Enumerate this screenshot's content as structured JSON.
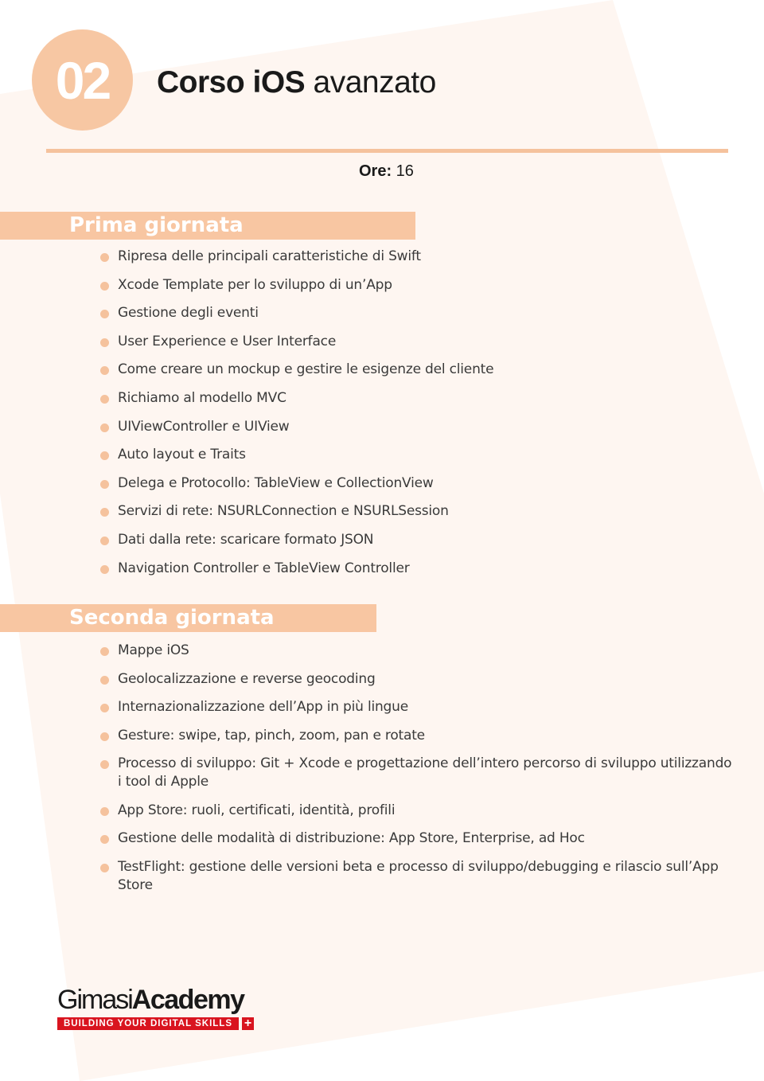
{
  "colors": {
    "accent": "#f8c6a2",
    "background_shape": "#fef6f1",
    "text": "#3a3a3a",
    "logo_red": "#d9141f"
  },
  "header": {
    "number": "02",
    "title_bold": "Corso iOS",
    "title_light": " avanzato",
    "hours_label": "Ore:",
    "hours_value": " 16"
  },
  "sections": [
    {
      "title": "Prima giornata",
      "items": [
        "Ripresa delle principali caratteristiche di Swift",
        "Xcode Template per lo sviluppo di un’App",
        "Gestione degli eventi",
        "User Experience e User Interface",
        "Come creare un mockup e gestire le esigenze del cliente",
        "Richiamo al modello MVC",
        "UIViewController e UIView",
        "Auto layout e Traits",
        "Delega e Protocollo: TableView e CollectionView",
        "Servizi di rete: NSURLConnection e NSURLSession",
        "Dati dalla rete: scaricare formato JSON",
        "Navigation Controller e TableView Controller"
      ]
    },
    {
      "title": "Seconda giornata",
      "items": [
        "Mappe iOS",
        "Geolocalizzazione  e reverse geocoding",
        "Internazionalizzazione dell’App in più lingue",
        "Gesture: swipe, tap, pinch, zoom, pan e rotate",
        "Processo di sviluppo: Git + Xcode e progettazione dell’intero percorso di sviluppo utilizzando i tool di Apple",
        "App Store: ruoli, certificati, identità, profili",
        "Gestione delle modalità di distribuzione: App Store, Enterprise, ad Hoc",
        "TestFlight: gestione delle versioni beta e processo di sviluppo/debugging e rilascio sull’App Store"
      ]
    }
  ],
  "logo": {
    "name_light": "Gimasi",
    "name_bold": "Academy",
    "tagline": "BUILDING YOUR DIGITAL SKILLS",
    "cross_icon": "swiss-cross-icon",
    "cross_glyph": "+"
  }
}
